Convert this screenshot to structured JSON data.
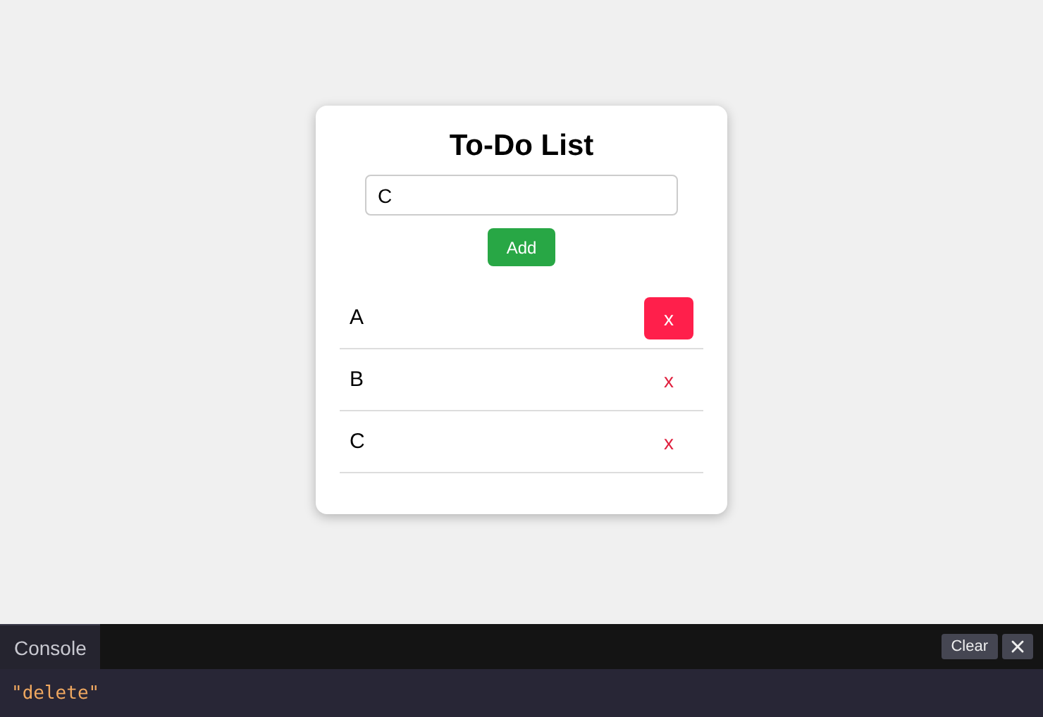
{
  "card": {
    "title": "To-Do List",
    "input": {
      "value": "C"
    },
    "add_button": "Add"
  },
  "items": [
    {
      "text": "A",
      "delete_label": "x",
      "hovered": true
    },
    {
      "text": "B",
      "delete_label": "x",
      "hovered": false
    },
    {
      "text": "C",
      "delete_label": "x",
      "hovered": false
    }
  ],
  "console": {
    "tab": {
      "label": "Console",
      "selected": true
    },
    "clear_button": "Clear",
    "output": "\"delete\""
  }
}
